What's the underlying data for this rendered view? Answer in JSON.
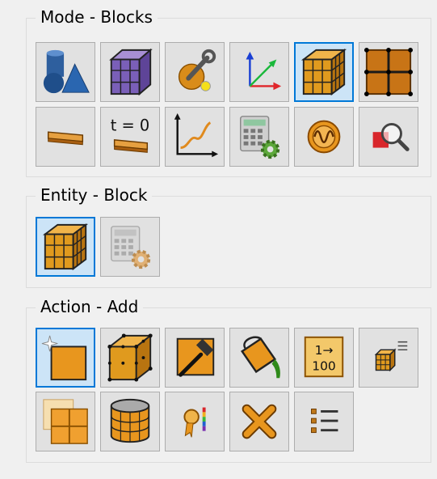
{
  "groups": {
    "mode": {
      "title": "Mode - Blocks"
    },
    "entity": {
      "title": "Entity - Block"
    },
    "action": {
      "title": "Action - Add"
    }
  },
  "mode_buttons": [
    {
      "icon": "shapes-icon",
      "selected": false
    },
    {
      "icon": "purple-block-grid-icon",
      "selected": false
    },
    {
      "icon": "wrench-sphere-icon",
      "selected": false
    },
    {
      "icon": "axes-xyz-icon",
      "selected": false
    },
    {
      "icon": "orange-block-icon",
      "selected": true
    },
    {
      "icon": "block-face-grid-icon",
      "selected": false
    },
    {
      "icon": "patch-icon",
      "selected": false
    },
    {
      "icon": "time-zero-patch-icon",
      "selected": false,
      "label": "t = 0"
    },
    {
      "icon": "graph-curve-icon",
      "selected": false
    },
    {
      "icon": "calculator-gear-icon",
      "selected": false
    },
    {
      "icon": "oscillator-icon",
      "selected": false
    },
    {
      "icon": "magnifier-check-icon",
      "selected": false
    }
  ],
  "entity_buttons": [
    {
      "icon": "orange-block-icon",
      "selected": true
    },
    {
      "icon": "calculator-gear-icon",
      "selected": false
    }
  ],
  "action_buttons": [
    {
      "icon": "new-block-sparkle-icon",
      "selected": true
    },
    {
      "icon": "block-vertices-icon",
      "selected": false
    },
    {
      "icon": "hammer-icon",
      "selected": false
    },
    {
      "icon": "paint-bucket-icon",
      "selected": false
    },
    {
      "icon": "numbering-icon",
      "selected": false,
      "label_top": "1→",
      "label_bottom": "100"
    },
    {
      "icon": "small-block-list-icon",
      "selected": false
    },
    {
      "icon": "split-block-icon",
      "selected": false
    },
    {
      "icon": "cylinder-block-icon",
      "selected": false
    },
    {
      "icon": "award-colorbar-icon",
      "selected": false
    },
    {
      "icon": "delete-x-icon",
      "selected": false
    },
    {
      "icon": "list-icon",
      "selected": false
    }
  ]
}
